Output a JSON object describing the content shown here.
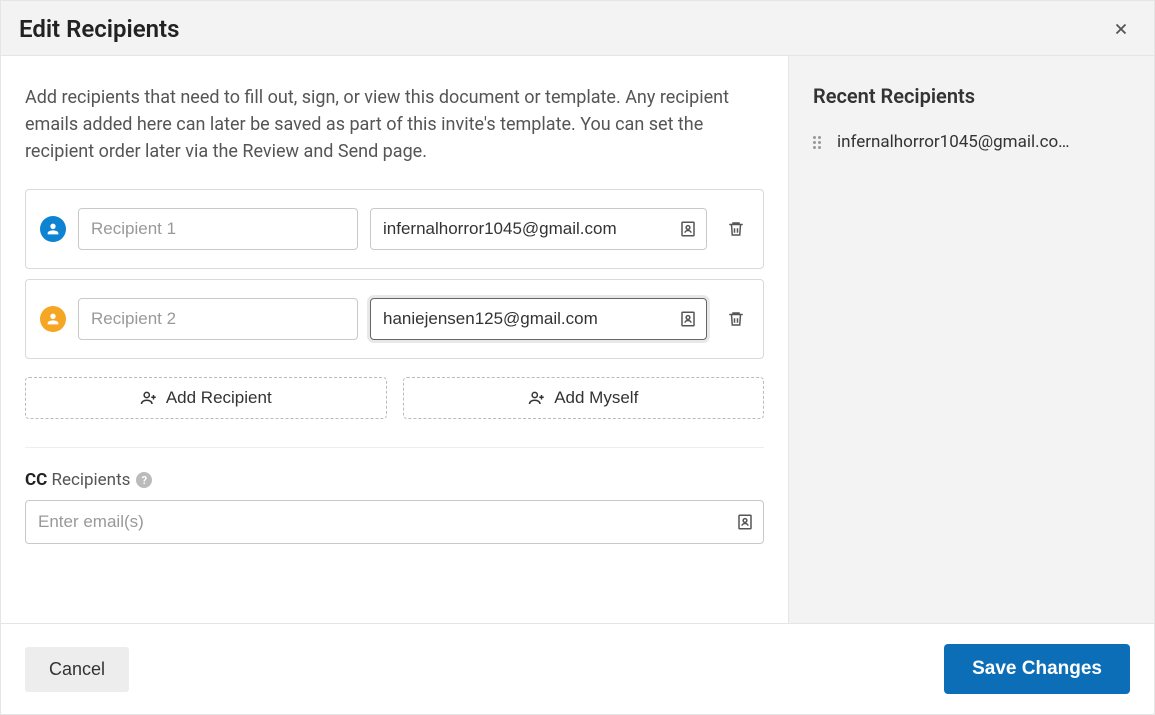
{
  "header": {
    "title": "Edit Recipients"
  },
  "intro_text": "Add recipients that need to fill out, sign, or view this document or template. Any recipient emails added here can later be saved as part of this invite's template. You can set the recipient order later via the Review and Send page.",
  "recipients": [
    {
      "name_placeholder": "Recipient 1",
      "email": "infernalhorror1045@gmail.com",
      "avatar_color": "blue"
    },
    {
      "name_placeholder": "Recipient 2",
      "email": "haniejensen125@gmail.com",
      "avatar_color": "orange",
      "focused": true
    }
  ],
  "buttons": {
    "add_recipient": "Add Recipient",
    "add_myself": "Add Myself",
    "cancel": "Cancel",
    "save": "Save Changes"
  },
  "cc": {
    "label_bold": "CC",
    "label_rest": "Recipients",
    "placeholder": "Enter email(s)"
  },
  "recent": {
    "title": "Recent Recipients",
    "items": [
      {
        "email": "infernalhorror1045@gmail.co…"
      }
    ]
  }
}
